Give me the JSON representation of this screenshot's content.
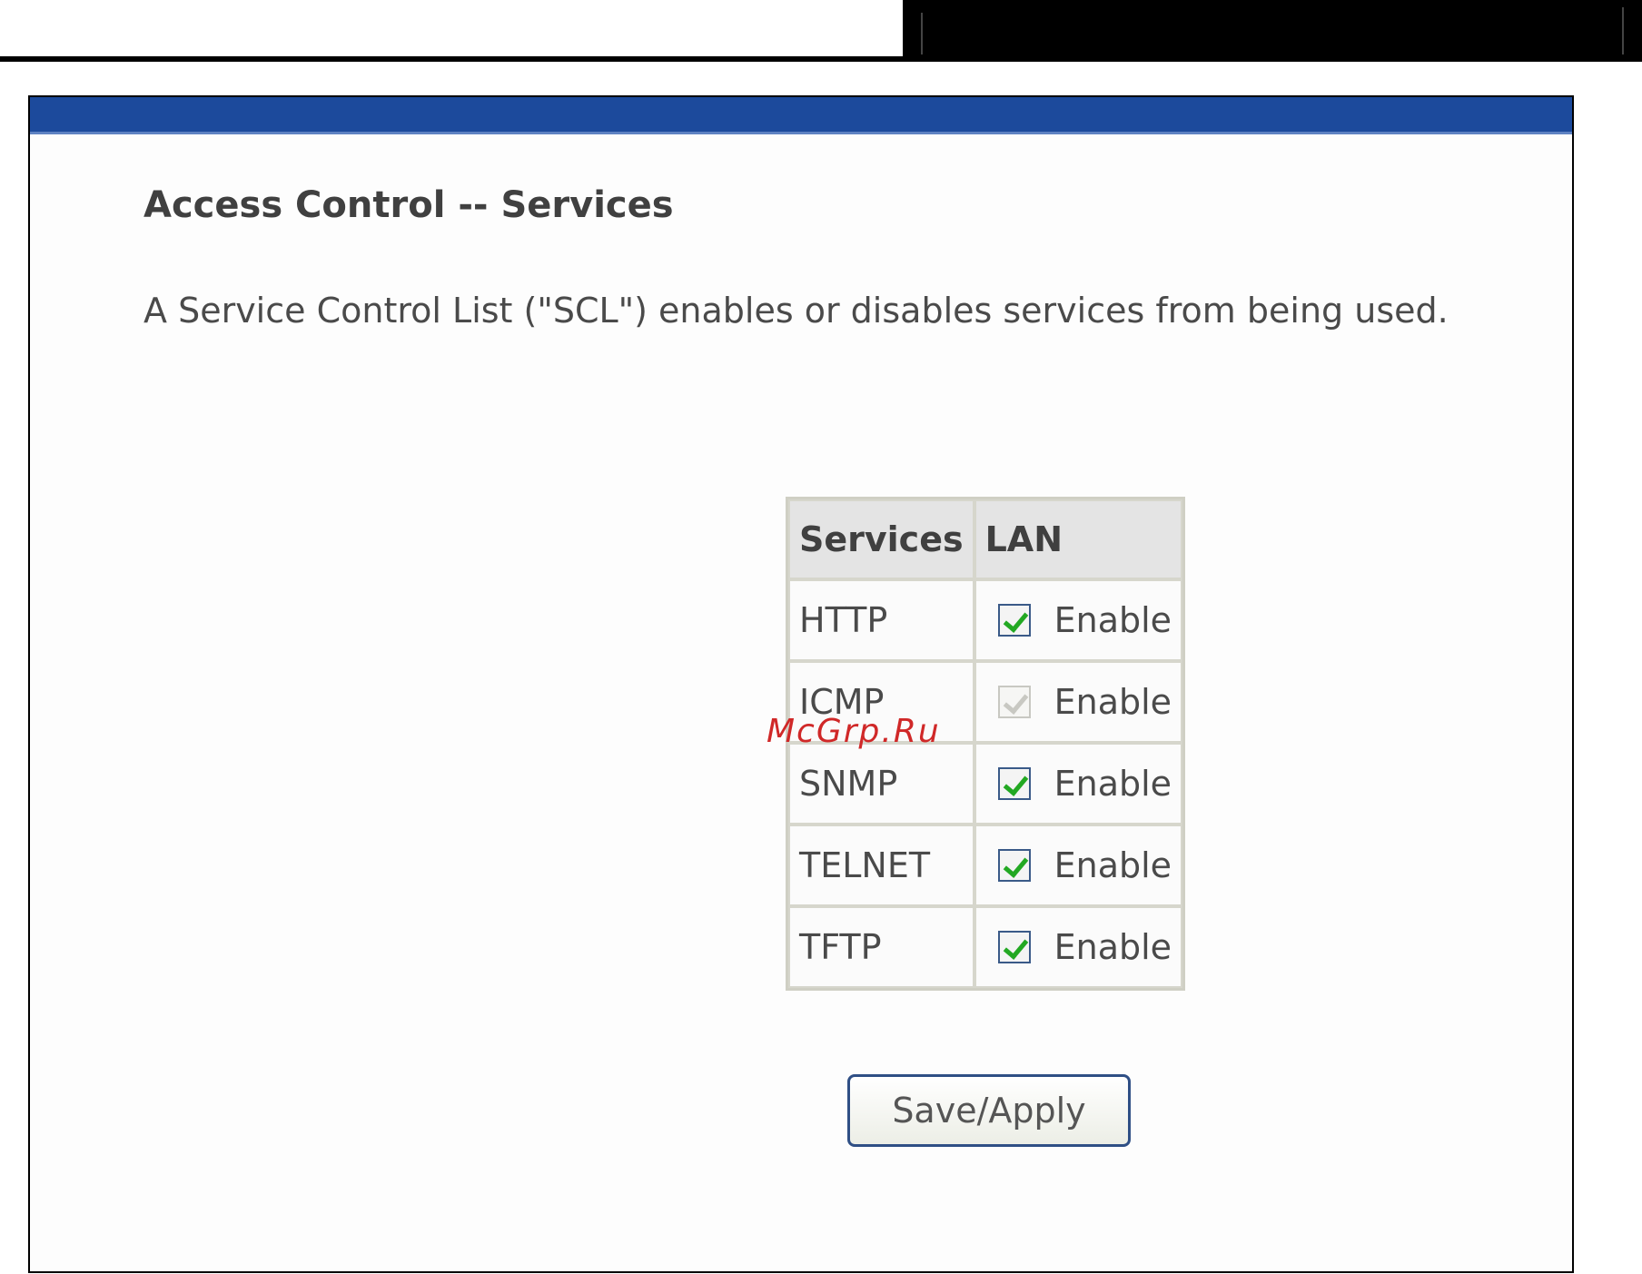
{
  "page": {
    "title": "Access Control -- Services",
    "description": "A Service Control List (\"SCL\") enables or disables services from being used."
  },
  "table": {
    "headers": {
      "services": "Services",
      "lan": "LAN"
    },
    "rows": [
      {
        "service": "HTTP",
        "lan_label": "Enable",
        "checked": true,
        "disabled": false
      },
      {
        "service": "ICMP",
        "lan_label": "Enable",
        "checked": true,
        "disabled": true
      },
      {
        "service": "SNMP",
        "lan_label": "Enable",
        "checked": true,
        "disabled": false
      },
      {
        "service": "TELNET",
        "lan_label": "Enable",
        "checked": true,
        "disabled": false
      },
      {
        "service": "TFTP",
        "lan_label": "Enable",
        "checked": true,
        "disabled": false
      }
    ]
  },
  "actions": {
    "save_apply_label": "Save/Apply"
  },
  "watermark": "McGrp.Ru",
  "colors": {
    "banner": "#1c4a9c",
    "checkmark": "#22a822",
    "watermark": "#d02828"
  }
}
